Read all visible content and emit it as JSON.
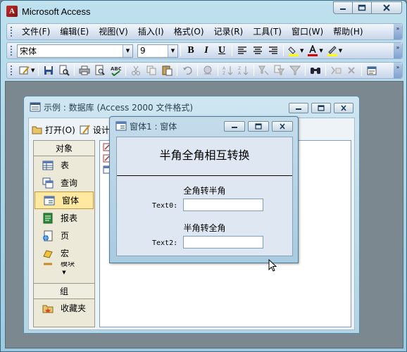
{
  "app": {
    "title": "Microsoft Access",
    "icon": "access-icon"
  },
  "menubar": {
    "items": [
      "文件(F)",
      "编辑(E)",
      "视图(V)",
      "插入(I)",
      "格式(O)",
      "记录(R)",
      "工具(T)",
      "窗口(W)",
      "帮助(H)"
    ]
  },
  "format_toolbar": {
    "font_name": "宋体",
    "font_size": "9",
    "bold_label": "B",
    "italic_label": "I",
    "underline_label": "U",
    "font_color": "#d40000",
    "fill_color": "#ffff00",
    "line_color": "#ffff00"
  },
  "db_window": {
    "title": "示例 : 数据库 (Access 2000 文件格式)",
    "open_label": "打开(O)",
    "design_label": "设计",
    "objects_header": "对象",
    "objects": [
      {
        "label": "表",
        "icon": "table-icon"
      },
      {
        "label": "查询",
        "icon": "query-icon"
      },
      {
        "label": "窗体",
        "icon": "form-icon",
        "selected": true
      },
      {
        "label": "报表",
        "icon": "report-icon"
      },
      {
        "label": "页",
        "icon": "page-icon"
      },
      {
        "label": "宏",
        "icon": "macro-icon"
      },
      {
        "label": "模块",
        "icon": "module-icon"
      }
    ],
    "groups_header": "组",
    "favorites_label": "收藏夹"
  },
  "form_window": {
    "title": "窗体1 : 窗体",
    "heading": "半角全角相互转换",
    "section1_label": "全角转半角",
    "field1_label": "Text0:",
    "field1_value": "",
    "section2_label": "半角转全角",
    "field2_label": "Text2:",
    "field2_value": ""
  }
}
